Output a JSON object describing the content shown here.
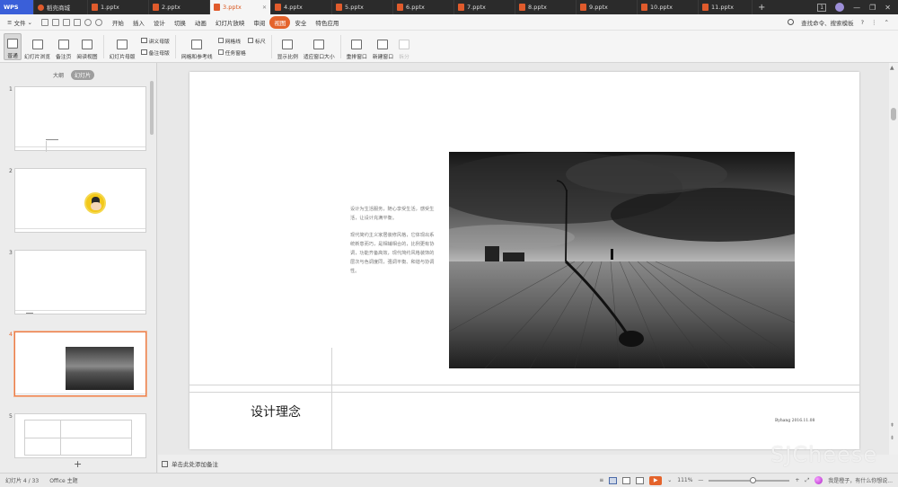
{
  "tabs": [
    {
      "label": "WPS",
      "kind": "wps"
    },
    {
      "label": "稻壳商城",
      "kind": "home"
    },
    {
      "label": "1.pptx",
      "kind": "doc"
    },
    {
      "label": "2.pptx",
      "kind": "doc"
    },
    {
      "label": "3.pptx",
      "kind": "active"
    },
    {
      "label": "4.pptx",
      "kind": "doc"
    },
    {
      "label": "5.pptx",
      "kind": "doc"
    },
    {
      "label": "6.pptx",
      "kind": "doc"
    },
    {
      "label": "7.pptx",
      "kind": "doc"
    },
    {
      "label": "8.pptx",
      "kind": "doc"
    },
    {
      "label": "9.pptx",
      "kind": "doc"
    },
    {
      "label": "10.pptx",
      "kind": "doc"
    },
    {
      "label": "11.pptx",
      "kind": "doc"
    }
  ],
  "window_badge": "1",
  "menu": {
    "file": "文件",
    "items": [
      "开始",
      "插入",
      "设计",
      "切换",
      "动画",
      "幻灯片放映",
      "审阅",
      "视图",
      "安全",
      "特色应用"
    ],
    "active": "视图",
    "search": "查找命令、搜索模板",
    "help": "?"
  },
  "ribbon": {
    "normal": "普通",
    "sorter": "幻灯片浏览",
    "notes_page": "备注页",
    "reading_view": "阅读视图",
    "slide_master": "幻灯片母版",
    "handout_master": "讲义母版",
    "notes_master": "备注母版",
    "grid_guides": "网格和参考线",
    "gridlines": "网格线",
    "ruler": "标尺",
    "task_pane": "任务窗格",
    "zoom": "显示比例",
    "fit_window": "适应窗口大小",
    "arrange_windows": "重排窗口",
    "new_window": "新建窗口",
    "disabled_btn": "拆分"
  },
  "panel": {
    "tab_outline": "大纲",
    "tab_slides": "幻灯片",
    "slide_numbers": [
      "1",
      "2",
      "3",
      "4",
      "5"
    ],
    "add_slide": "+"
  },
  "slide": {
    "body_p1": "设计为生活服务，随心享受生活，感受生活，让设计充满平衡。",
    "body_p2": "现代简约主义家居装修风格，它体现出系统新意而巧，是相辅相合的，比例更有协调，功能齐备高效，现代简约风格装饰的层次与色调度同，强调平衡、和谐与协调性。",
    "title": "设计理念",
    "byline": "Byhang 2016.11.08"
  },
  "notes_placeholder": "单击此处添加备注",
  "status": {
    "slide_pos": "幻灯片 4 / 33",
    "theme": "Office 主题",
    "zoom": "111%",
    "zoom_minus": "—",
    "zoom_plus": "+",
    "user_hint": "我是橙子，有什么你想说..."
  },
  "watermark": "SJCheese",
  "colors": {
    "accent": "#e4632b",
    "wps_blue": "#3a5fd9",
    "tab_dark": "#2b2b2b"
  }
}
